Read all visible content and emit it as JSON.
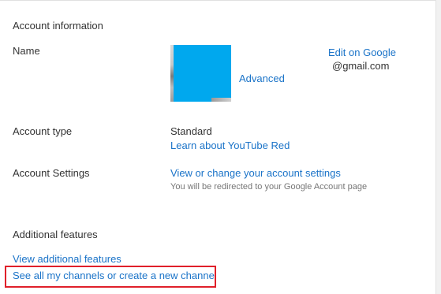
{
  "account": {
    "heading": "Account information",
    "name_label": "Name",
    "edit_link": "Edit on Google",
    "email": "@gmail.com",
    "advanced_link": "Advanced",
    "account_type_label": "Account type",
    "account_type_value": "Standard",
    "learn_link": "Learn about YouTube Red",
    "settings_label": "Account Settings",
    "settings_link": "View or change your account settings",
    "settings_note": "You will be redirected to your Google Account page"
  },
  "additional": {
    "heading": "Additional features",
    "view_link": "View additional features",
    "channels_link": "See all my channels or create a new channel"
  },
  "colors": {
    "link": "#1a73c8",
    "highlight": "#e0202a",
    "avatar_cover": "#00a8ee"
  }
}
